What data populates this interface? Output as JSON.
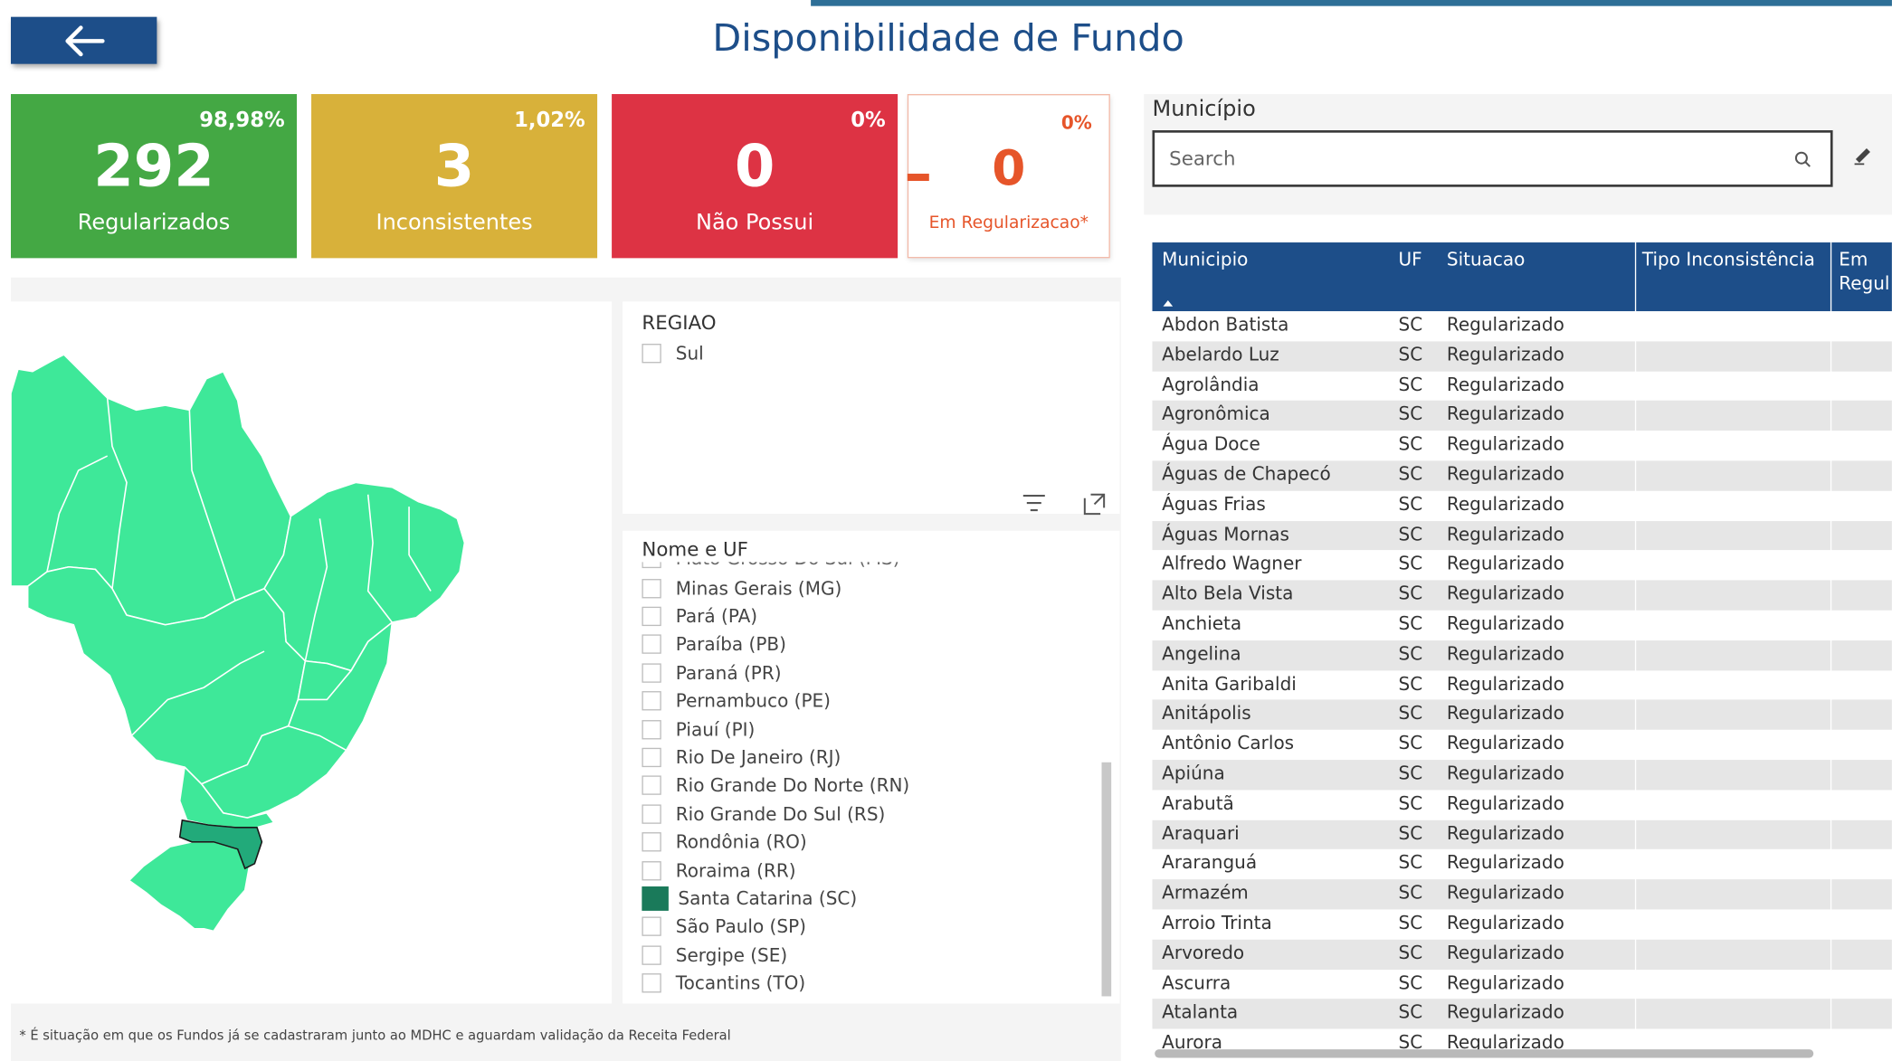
{
  "header": {
    "title": "Disponibilidade de Fundo"
  },
  "colors": {
    "brand": "#1d4e89",
    "green": "#44a844",
    "yellow": "#d8b13a",
    "red": "#dd3344",
    "orange": "#e6552a",
    "map": "#3ee899",
    "selected": "#1a7a5a"
  },
  "kpis": [
    {
      "value": "292",
      "percent": "98,98%",
      "label": "Regularizados"
    },
    {
      "value": "3",
      "percent": "1,02%",
      "label": "Inconsistentes"
    },
    {
      "value": "0",
      "percent": "0%",
      "label": "Não Possui"
    },
    {
      "value": "0",
      "percent": "0%",
      "label": "Em Regularizacao*"
    }
  ],
  "regiao": {
    "title": "REGIAO",
    "items": [
      "Sul"
    ]
  },
  "uf_slicer": {
    "title": "Nome e UF",
    "partial_item": "Mato Grosso Do Sul (MS)",
    "items": [
      "Minas Gerais (MG)",
      "Pará (PA)",
      "Paraíba (PB)",
      "Paraná (PR)",
      "Pernambuco (PE)",
      "Piauí (PI)",
      "Rio De Janeiro (RJ)",
      "Rio Grande Do Norte (RN)",
      "Rio Grande Do Sul (RS)",
      "Rondônia (RO)",
      "Roraima (RR)",
      "Santa Catarina (SC)",
      "São Paulo (SP)",
      "Sergipe (SE)",
      "Tocantins (TO)"
    ],
    "selected": "Santa Catarina (SC)"
  },
  "footnote": "* É situação em que os Fundos já se cadastraram junto ao MDHC e aguardam validação da Receita Federal",
  "municipio": {
    "label": "Município",
    "search_placeholder": "Search"
  },
  "table": {
    "columns": [
      "Municipio",
      "UF",
      "Situacao",
      "Tipo Inconsistência",
      "Em Regul"
    ],
    "rows": [
      [
        "Abdon Batista",
        "SC",
        "Regularizado"
      ],
      [
        "Abelardo Luz",
        "SC",
        "Regularizado"
      ],
      [
        "Agrolândia",
        "SC",
        "Regularizado"
      ],
      [
        "Agronômica",
        "SC",
        "Regularizado"
      ],
      [
        "Água Doce",
        "SC",
        "Regularizado"
      ],
      [
        "Águas de Chapecó",
        "SC",
        "Regularizado"
      ],
      [
        "Águas Frias",
        "SC",
        "Regularizado"
      ],
      [
        "Águas Mornas",
        "SC",
        "Regularizado"
      ],
      [
        "Alfredo Wagner",
        "SC",
        "Regularizado"
      ],
      [
        "Alto Bela Vista",
        "SC",
        "Regularizado"
      ],
      [
        "Anchieta",
        "SC",
        "Regularizado"
      ],
      [
        "Angelina",
        "SC",
        "Regularizado"
      ],
      [
        "Anita Garibaldi",
        "SC",
        "Regularizado"
      ],
      [
        "Anitápolis",
        "SC",
        "Regularizado"
      ],
      [
        "Antônio Carlos",
        "SC",
        "Regularizado"
      ],
      [
        "Apiúna",
        "SC",
        "Regularizado"
      ],
      [
        "Arabutã",
        "SC",
        "Regularizado"
      ],
      [
        "Araquari",
        "SC",
        "Regularizado"
      ],
      [
        "Araranguá",
        "SC",
        "Regularizado"
      ],
      [
        "Armazém",
        "SC",
        "Regularizado"
      ],
      [
        "Arroio Trinta",
        "SC",
        "Regularizado"
      ],
      [
        "Arvoredo",
        "SC",
        "Regularizado"
      ],
      [
        "Ascurra",
        "SC",
        "Regularizado"
      ],
      [
        "Atalanta",
        "SC",
        "Regularizado"
      ],
      [
        "Aurora",
        "SC",
        "Regularizado"
      ]
    ]
  }
}
